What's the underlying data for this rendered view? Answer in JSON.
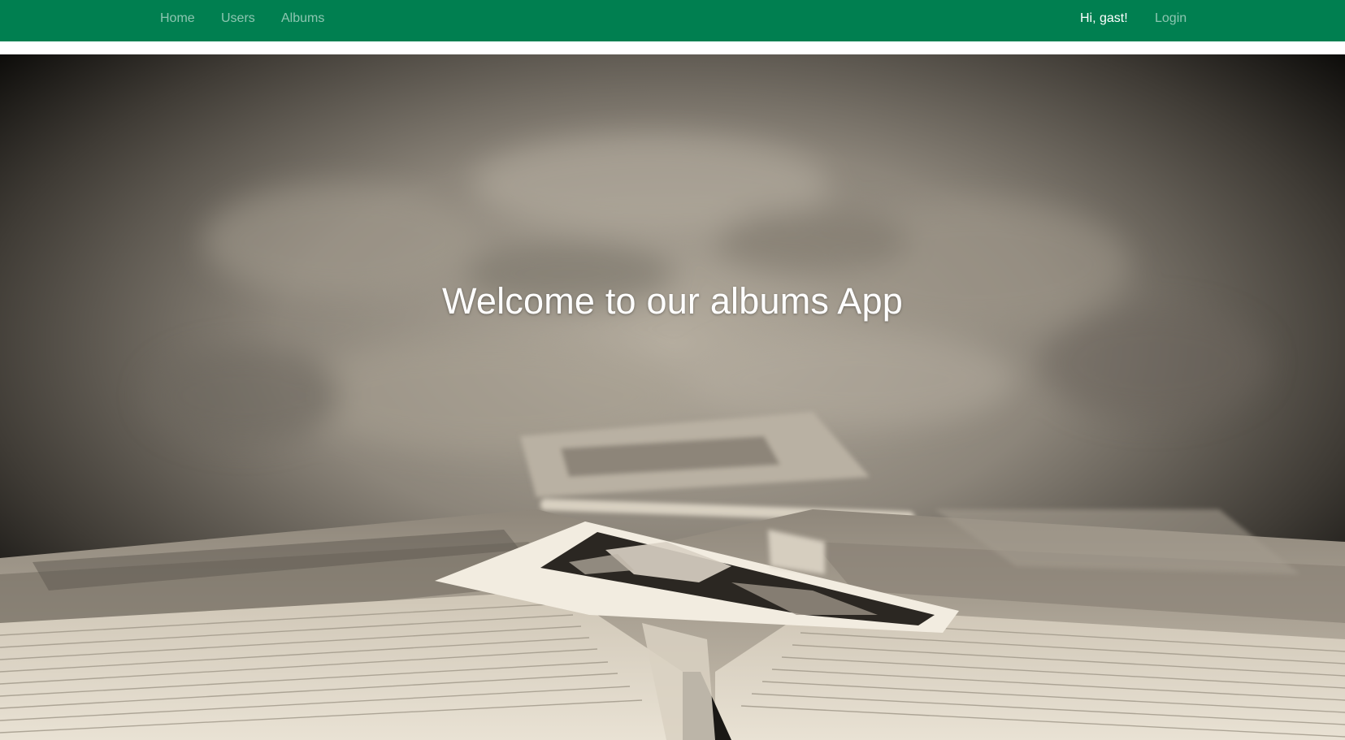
{
  "nav": {
    "links": [
      {
        "label": "Home"
      },
      {
        "label": "Users"
      },
      {
        "label": "Albums"
      }
    ],
    "greeting": "Hi, gast!",
    "login_label": "Login"
  },
  "hero": {
    "title": "Welcome to our albums App"
  },
  "colors": {
    "navbar": "#007f50",
    "hero_text": "#ffffff"
  }
}
